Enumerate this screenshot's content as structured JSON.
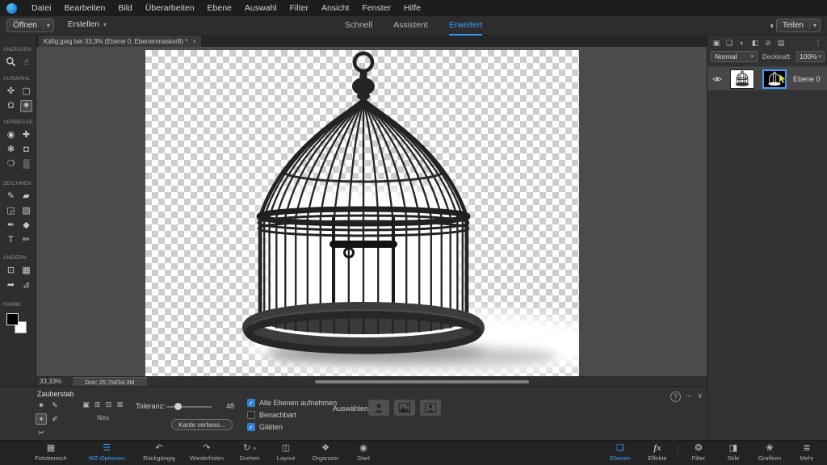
{
  "accent": "#2f9bff",
  "menubar": {
    "items": [
      "Datei",
      "Bearbeiten",
      "Bild",
      "Überarbeiten",
      "Ebene",
      "Auswahl",
      "Filter",
      "Ansicht",
      "Fenster",
      "Hilfe"
    ]
  },
  "actionbar": {
    "open": "Öffnen",
    "create": "Erstellen",
    "share": "Teilen",
    "tabs": [
      "Schnell",
      "Assistent",
      "Erweitert"
    ],
    "active_tab": "Erweitert"
  },
  "document": {
    "tab_title": "Käfig.jpeg bei 33,3% (Ebene 0, Ebenenmaske/8) *",
    "zoom_level": "33,33%",
    "doc_info": "Dok: 25,7M/34,3M"
  },
  "toolbox": {
    "labels": {
      "view": "ANZEIGEN",
      "select": "AUSWÄHL",
      "enhance": "VERBESSE...",
      "draw": "ZEICHNEN",
      "modify": "ÄNDERN",
      "color": "FARBE"
    }
  },
  "icons": {
    "hand": "☝",
    "move": "✜",
    "marquee": "▢",
    "lasso": "Ω",
    "quick_select": "✷",
    "red_eye": "◉",
    "spot_heal": "✚",
    "smart_brush": "❃",
    "clone_stamp": "◘",
    "blur": "❍",
    "sponge": "▒",
    "brush": "✎",
    "eraser": "▰",
    "bucket": "◲",
    "gradient": "▧",
    "eyedropper": "✒",
    "shape": "◆",
    "type": "T",
    "pencil": "✏",
    "crop": "⊡",
    "recompose": "▦",
    "content_move": "➦",
    "straighten": "⊿",
    "mode_new": "▣",
    "mode_add": "⊞",
    "mode_sub": "⊟",
    "mode_intersect": "⊠",
    "variant_a": "✷",
    "variant_b": "✎",
    "variant_c": "✶",
    "variant_d": "✐",
    "variant_e": "✂",
    "help": "?",
    "ellipsis": "⋯",
    "collapse": "∨",
    "check": "✓",
    "close": "×",
    "caret": "▾",
    "theme": "◐",
    "panel_new_layer": "▣",
    "panel_new_group": "❏",
    "panel_adjust": "◐",
    "panel_mask": "◧",
    "panel_lock": "⊘",
    "panel_menu": "▤",
    "panel_kebab": "⋮",
    "tb_fotobereich": "▦",
    "tb_wz": "☰",
    "tb_undo": "↶",
    "tb_redo": "↷",
    "tb_rotate": "↻",
    "tb_layout": "◫",
    "tb_organizer": "❖",
    "tb_start": "◉",
    "tb_ebenen": "❏",
    "tb_effekte": "fx",
    "tb_filter": "❂",
    "tb_stile": "◨",
    "tb_grafiken": "❀",
    "tb_mehr": "≣"
  },
  "tool_options": {
    "title": "Zauberstab",
    "new_label": "Neu",
    "tolerance_label": "Toleranz:",
    "tolerance_value": "48",
    "checks": [
      {
        "label": "Alle Ebenen aufnehmen",
        "checked": true
      },
      {
        "label": "Benachbart",
        "checked": false
      },
      {
        "label": "Glätten",
        "checked": true
      }
    ],
    "refine_button": "Kante verbess...",
    "select_label": "Auswählen:"
  },
  "layers_panel": {
    "blend_mode": "Normal",
    "opacity_label": "Deckkraft:",
    "opacity_value": "100%",
    "layer_name": "Ebene 0"
  },
  "taskbar": {
    "left": [
      "Fotobereich",
      "WZ-Optionen",
      "Rückgängig",
      "Wiederholen",
      "Drehen",
      "Layout",
      "Organizer",
      "Start"
    ],
    "right": [
      "Ebenen",
      "Effekte",
      "Filter",
      "Stile",
      "Grafiken",
      "Mehr"
    ],
    "active_left": "WZ-Optionen",
    "active_right": "Ebenen"
  }
}
